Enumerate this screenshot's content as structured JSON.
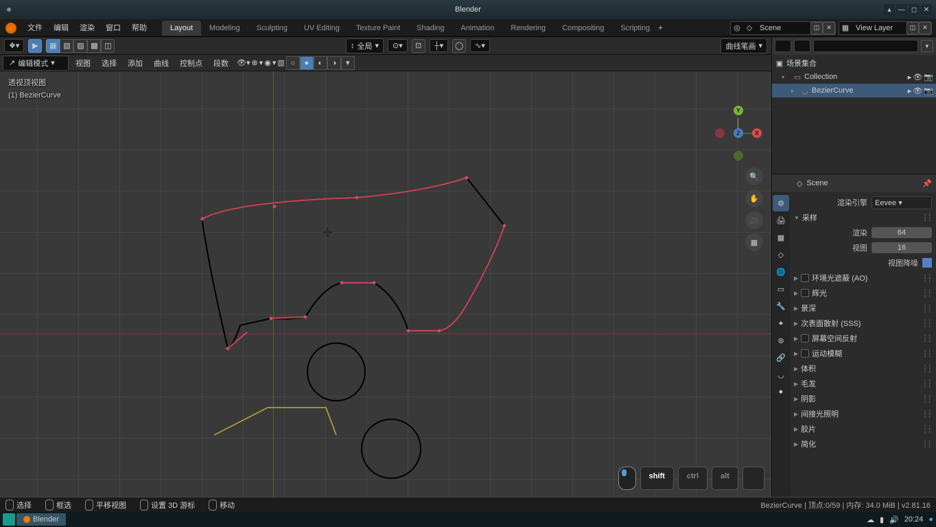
{
  "window": {
    "title": "Blender"
  },
  "top_menu": [
    "文件",
    "编辑",
    "渲染",
    "窗口",
    "帮助"
  ],
  "workspace_tabs": [
    "Layout",
    "Modeling",
    "Sculpting",
    "UV Editing",
    "Texture Paint",
    "Shading",
    "Animation",
    "Rendering",
    "Compositing",
    "Scripting"
  ],
  "workspace_active": 0,
  "scene": {
    "name": "Scene"
  },
  "view_layer": {
    "name": "View Layer"
  },
  "viewport": {
    "mode_dd": "编辑模式",
    "orientation": "全局",
    "pivot": "曲线笔画",
    "menus": [
      "视图",
      "选择",
      "添加",
      "曲线",
      "控制点",
      "段数"
    ],
    "overlay_view": "透视顶视图",
    "overlay_obj": "(1) BezierCurve"
  },
  "key_overlay": {
    "shift": "shift",
    "ctrl": "ctrl",
    "alt": "alt"
  },
  "outliner": {
    "root": "场景集合",
    "collection": "Collection",
    "object": "BezierCurve",
    "search_placeholder": ""
  },
  "properties": {
    "breadcrumb": "Scene",
    "render_engine_lbl": "渲染引擎",
    "render_engine_val": "Eevee",
    "sampling_hdr": "采样",
    "render_lbl": "渲染",
    "render_val": "64",
    "viewport_lbl": "视图",
    "viewport_val": "16",
    "denoise_lbl": "视图降噪",
    "panels": [
      "环境光遮蔽 (AO)",
      "辉光",
      "景深",
      "次表面散射 (SSS)",
      "屏幕空间反射",
      "运动模糊",
      "体积",
      "毛发",
      "阴影",
      "间接光照明",
      "胶片",
      "简化"
    ],
    "panel_checkbox": [
      true,
      true,
      false,
      false,
      true,
      true,
      false,
      false,
      false,
      false,
      false,
      false
    ]
  },
  "statusbar": {
    "hints": [
      "选择",
      "框选",
      "平移视图",
      "设置 3D 游标",
      "移动"
    ],
    "info": "BezierCurve | 顶点:0/59 | 内存: 34.0 MiB | v2.81.16"
  },
  "taskbar": {
    "app": "Blender",
    "time": "20:24"
  }
}
